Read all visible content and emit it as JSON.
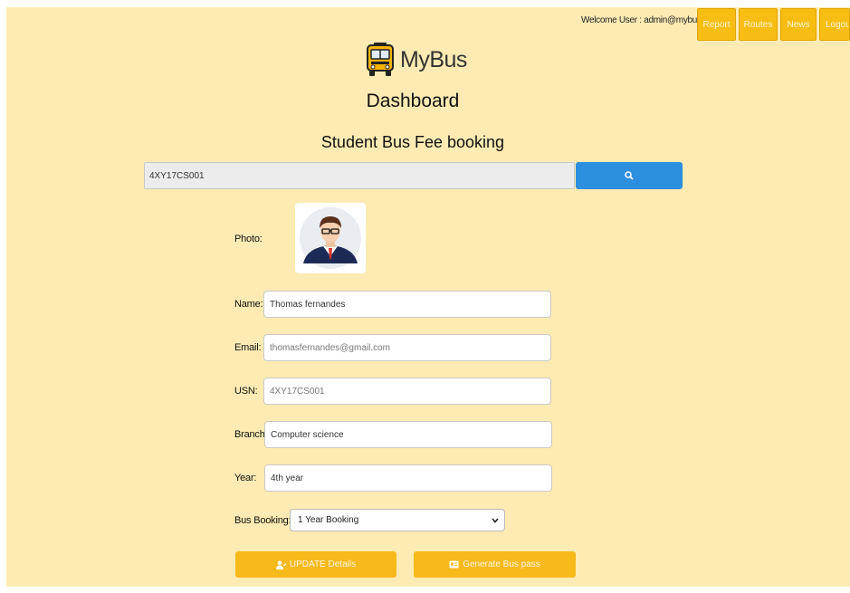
{
  "header": {
    "welcome": "Welcome User : admin@mybus.com",
    "nav": [
      "Report",
      "Routes",
      "News",
      "Logou"
    ]
  },
  "brand": {
    "name": "MyBus",
    "icon": "bus-icon"
  },
  "page_title": "Dashboard",
  "section_title": "Student Bus Fee booking",
  "search": {
    "value": "4XY17CS001",
    "icon": "search-icon",
    "color": "#2d8fe0"
  },
  "form": {
    "photo_label": "Photo:",
    "name_label": "Name:",
    "name_value": "Thomas fernandes",
    "email_label": "Email:",
    "email_value": "thomasfernandes@gmail.com",
    "usn_label": "USN:",
    "usn_value": "4XY17CS001",
    "branch_label": "Branch:",
    "branch_value": "Computer science",
    "year_label": "Year:",
    "year_value": "4th year",
    "booking_label": "Bus Booking:",
    "booking_value": "1 Year Booking"
  },
  "actions": {
    "update_label": "UPDATE Details",
    "update_icon": "user-icon",
    "pass_label": "Generate Bus pass",
    "pass_icon": "id-card-icon"
  },
  "colors": {
    "background": "#fdebb3",
    "accent": "#f8bd13",
    "primary": "#2d8fe0"
  }
}
